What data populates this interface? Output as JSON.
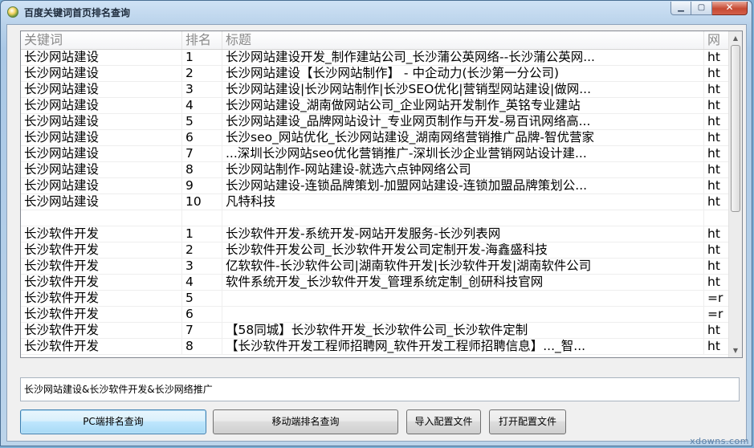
{
  "window": {
    "title": "百度关键词首页排名查询",
    "minimize": "▁",
    "maximize": "▢",
    "close": "✕"
  },
  "grid": {
    "columns": [
      "关键词",
      "排名",
      "标题",
      "网"
    ],
    "rows": [
      [
        "长沙网站建设",
        "1",
        "长沙网站建设开发_制作建站公司_长沙蒲公英网络--长沙蒲公英网...",
        "ht"
      ],
      [
        "长沙网站建设",
        "2",
        "长沙网站建设【长沙网站制作】 - 中企动力(长沙第一分公司)",
        "ht"
      ],
      [
        "长沙网站建设",
        "3",
        "长沙网站建设|长沙网站制作|长沙SEO优化|营销型网站建设|做网...",
        "ht"
      ],
      [
        "长沙网站建设",
        "4",
        "长沙网站建设_湖南做网站公司_企业网站开发制作_英铭专业建站",
        "ht"
      ],
      [
        "长沙网站建设",
        "5",
        "长沙网站建设_品牌网站设计_专业网页制作与开发-易百讯网络高...",
        "ht"
      ],
      [
        "长沙网站建设",
        "6",
        "长沙seo_网站优化_长沙网站建设_湖南网络营销推广品牌-智优营家",
        "ht"
      ],
      [
        "长沙网站建设",
        "7",
        "...深圳长沙网站seo优化营销推广-深圳长沙企业营销网站设计建...",
        "ht"
      ],
      [
        "长沙网站建设",
        "8",
        "长沙网站制作-网站建设-就选六点钟网络公司",
        "ht"
      ],
      [
        "长沙网站建设",
        "9",
        "长沙网站建设-连锁品牌策划-加盟网站建设-连锁加盟品牌策划公...",
        "ht"
      ],
      [
        "长沙网站建设",
        "10",
        "凡特科技",
        "ht"
      ],
      [
        "",
        "",
        "",
        ""
      ],
      [
        "长沙软件开发",
        "1",
        "长沙软件开发-系统开发-网站开发服务-长沙列表网",
        "ht"
      ],
      [
        "长沙软件开发",
        "2",
        "长沙软件开发公司_长沙软件开发公司定制开发-海鑫盛科技",
        "ht"
      ],
      [
        "长沙软件开发",
        "3",
        "亿软软件-长沙软件公司|湖南软件开发|长沙软件开发|湖南软件公司",
        "ht"
      ],
      [
        "长沙软件开发",
        "4",
        "软件系统开发_长沙软件开发_管理系统定制_创研科技官网",
        "ht"
      ],
      [
        "长沙软件开发",
        "5",
        "",
        "=r"
      ],
      [
        "长沙软件开发",
        "6",
        "",
        "=r"
      ],
      [
        "长沙软件开发",
        "7",
        "【58同城】长沙软件开发_长沙软件公司_长沙软件定制",
        "ht"
      ],
      [
        "长沙软件开发",
        "8",
        "【长沙软件开发工程师招聘网_软件开发工程师招聘信息】..._智...",
        "ht"
      ]
    ],
    "scroll_up": "▲",
    "scroll_down": "▼"
  },
  "query_input": {
    "value": "长沙网站建设&长沙软件开发&长沙网络推广"
  },
  "buttons": {
    "pc": "PC端排名查询",
    "mobile": "移动端排名查询",
    "import": "导入配置文件",
    "open": "打开配置文件"
  },
  "watermark": "xdowns.com"
}
